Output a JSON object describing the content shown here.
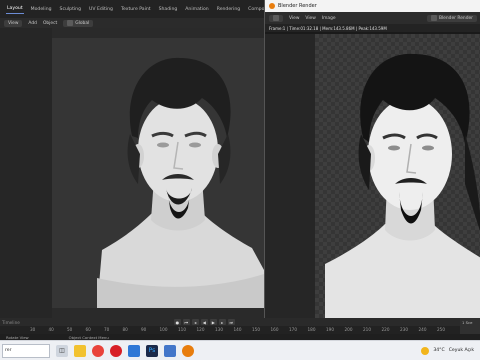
{
  "main_window": {
    "workspace_tabs": [
      "Layout",
      "Modeling",
      "Sculpting",
      "UV Editing",
      "Texture Paint",
      "Shading",
      "Animation",
      "Rendering",
      "Compositing",
      "Geometry Nodes",
      "Sc"
    ],
    "active_tab": "Layout",
    "header": {
      "view": "View",
      "add": "Add",
      "object": "Object",
      "transform": "Global"
    }
  },
  "render_window": {
    "title": "Blender Render",
    "menu": {
      "view": "View",
      "view2": "View",
      "image": "Image"
    },
    "slot": "Blender Render",
    "status": "Frame:1 | Time:01:32.18 | Mem:143.5.86M | Peak:143.59M"
  },
  "timeline": {
    "label": "Timeline",
    "ticks": [
      "30",
      "40",
      "50",
      "60",
      "70",
      "80",
      "90",
      "100",
      "110",
      "120",
      "130",
      "140",
      "150",
      "160",
      "170",
      "180",
      "190",
      "200",
      "210",
      "220",
      "230",
      "240",
      "250"
    ],
    "status_left": "Rotate View",
    "status_mid": "Object Context Menu",
    "right_panel": "1 Sce"
  },
  "taskbar": {
    "search_text": "rer",
    "weather": "34°C",
    "weather_desc": "Ceyuk Açık"
  },
  "colors": {
    "accent": "#6c8cd5",
    "blender_orange": "#e87d0d"
  }
}
